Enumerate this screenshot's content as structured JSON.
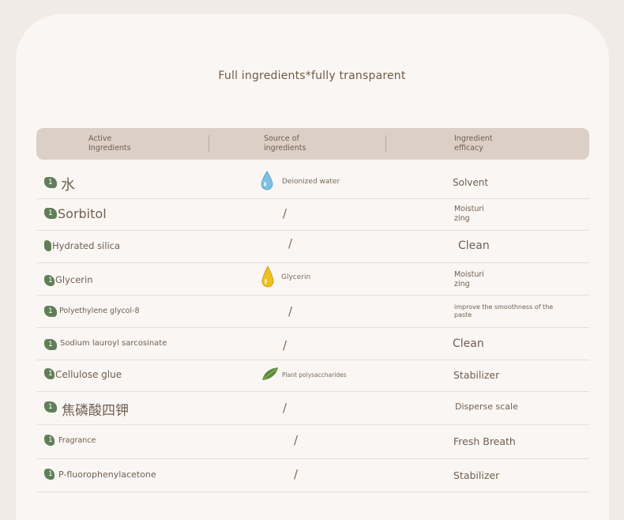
{
  "title": "Full ingredients*fully transparent",
  "columns": {
    "active": [
      "Active",
      "Ingredients"
    ],
    "source": [
      "Source of",
      "ingredients"
    ],
    "efficacy": [
      "Ingredient",
      "efficacy"
    ]
  },
  "badge_label": "1",
  "rows": [
    {
      "name": "水",
      "source": "Deionized water",
      "source_icon": "water-drop-icon",
      "efficacy": "Solvent"
    },
    {
      "name": "Sorbitol",
      "source": "/",
      "efficacy": [
        "Moisturi",
        "zing"
      ]
    },
    {
      "name": "Hydrated silica",
      "source": "/",
      "efficacy": "Clean"
    },
    {
      "name": "Glycerin",
      "source": "Glycerin",
      "source_icon": "oil-drop-icon",
      "efficacy": [
        "Moisturi",
        "zing"
      ]
    },
    {
      "name": "Polyethylene glycol-8",
      "source": "/",
      "efficacy": [
        "improve the smoothness of the",
        "paste"
      ]
    },
    {
      "name": "Sodium lauroyl sarcosinate",
      "source": "/",
      "efficacy": "Clean"
    },
    {
      "name": "Cellulose glue",
      "source": "Plant polysaccharides",
      "source_icon": "leaf-icon",
      "efficacy": "Stabilizer"
    },
    {
      "name": "焦磷酸四钾",
      "source": "/",
      "efficacy": "Disperse scale"
    },
    {
      "name": "Fragrance",
      "source": "/",
      "efficacy": "Fresh Breath"
    },
    {
      "name": "P-fluorophenylacetone",
      "source": "/",
      "efficacy": "Stabilizer"
    }
  ],
  "colors": {
    "badge": "#5f7f57",
    "header_bg": "#dccfc5",
    "card_bg": "#faf6f4"
  }
}
